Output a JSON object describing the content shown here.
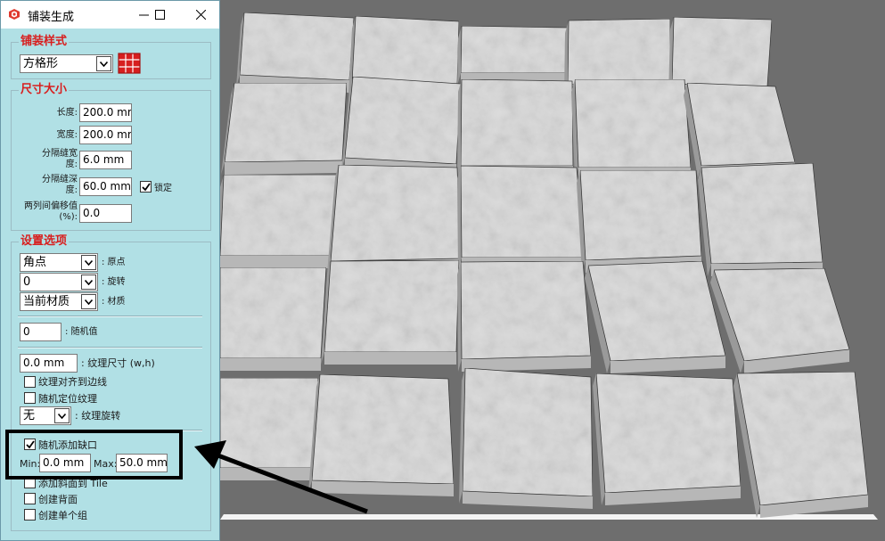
{
  "window": {
    "title": "铺装生成"
  },
  "groups": {
    "style": "铺装样式",
    "size": "尺寸大小",
    "options": "设置选项"
  },
  "style": {
    "pattern": "方格形"
  },
  "size": {
    "length_label": "长度:",
    "length": "200.0 mm",
    "width_label": "宽度:",
    "width": "200.0 mm",
    "gap_width_label": "分隔缝宽度:",
    "gap_width": "6.0 mm",
    "gap_depth_label": "分隔缝深度:",
    "gap_depth": "60.0 mm",
    "lock_label": "锁定",
    "lock_checked": true,
    "offset_label": "两列间偏移值(%):",
    "offset": "0.0"
  },
  "options": {
    "origin": "角点",
    "origin_label": ": 原点",
    "rotation": "0",
    "rotation_label": ": 旋转",
    "material": "当前材质",
    "material_label": ": 材质",
    "random_value": "0",
    "random_label": ": 随机值",
    "texture_size": "0.0 mm",
    "texture_size_label": ": 纹理尺寸 (w,h)",
    "align_texture_label": "纹理对齐到边线",
    "random_texture_label": "随机定位纹理",
    "texture_rotation": "无",
    "texture_rotation_label": ": 纹理旋转",
    "random_notch_label": "随机添加缺口",
    "random_notch_checked": true,
    "min_label": "Min:",
    "min_value": "0.0 mm",
    "max_label": "Max:",
    "max_value": "50.0 mm",
    "slope_label": "添加斜面到 Tile",
    "backface_label": "创建背面",
    "single_group_label": "创建单个组"
  },
  "colors": {
    "dialog_bg": "#b1e0e5",
    "group_title": "#d81e1e",
    "viewport_bg": "#6e6e6e",
    "tile_top": "#dcdcdc",
    "tile_side": "#9a9a9a"
  },
  "icons": [
    "app-logo-icon",
    "minimize-icon",
    "maximize-icon",
    "close-icon",
    "pattern-preview-icon",
    "chevron-down-icon",
    "checkmark-icon",
    "arrow-pointer"
  ]
}
